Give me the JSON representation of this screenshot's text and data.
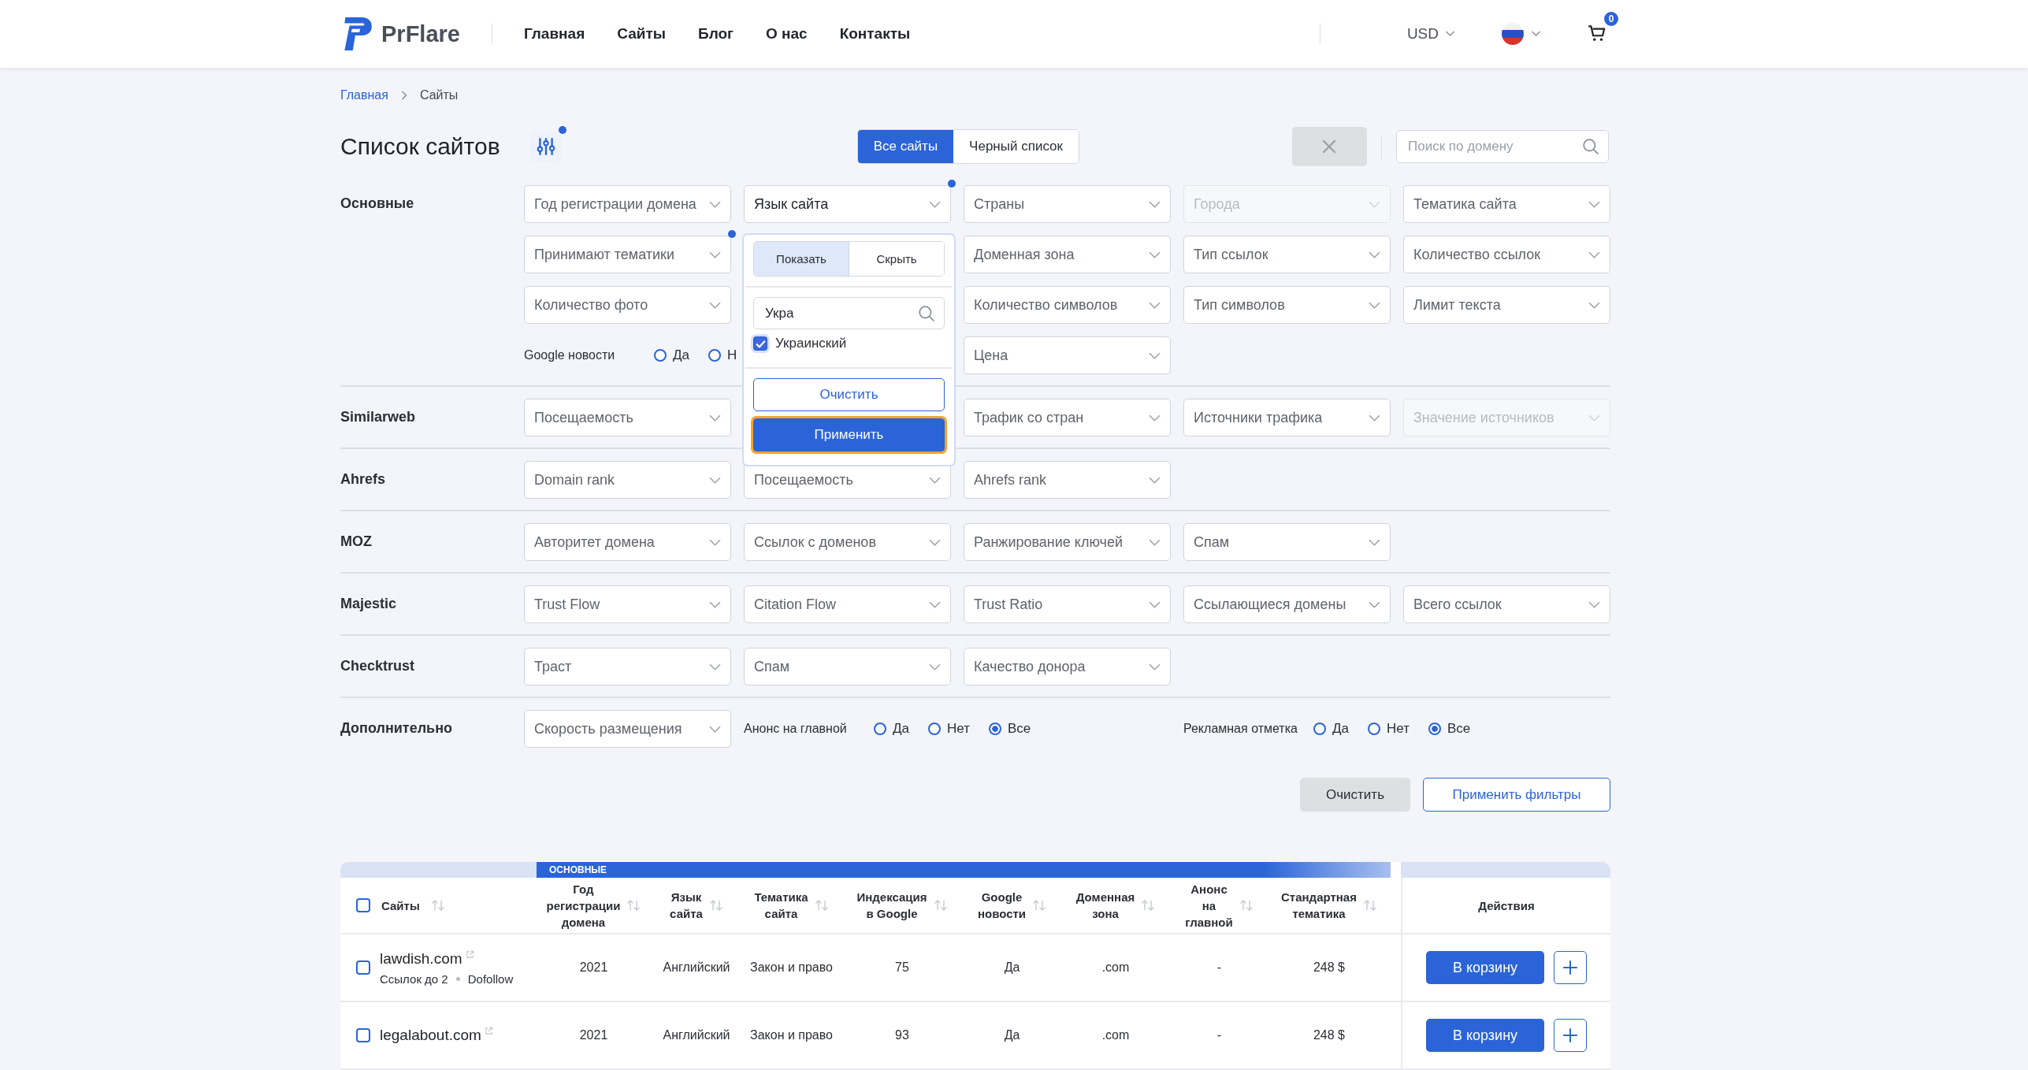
{
  "header": {
    "logo": "PrFlare",
    "nav": [
      {
        "label": "Главная"
      },
      {
        "label": "Сайты"
      },
      {
        "label": "Блог"
      },
      {
        "label": "О нас"
      },
      {
        "label": "Контакты"
      }
    ],
    "currency": "USD",
    "cart_count": "0"
  },
  "breadcrumbs": [
    {
      "label": "Главная",
      "link": true
    },
    {
      "label": "Сайты",
      "link": false
    }
  ],
  "page_title": "Список сайтов",
  "filter_toggle": {
    "active": true
  },
  "tabs": [
    {
      "label": "Все сайты",
      "selected": true
    },
    {
      "label": "Черный список",
      "selected": false
    }
  ],
  "reset_disabled": true,
  "search": {
    "placeholder": "Поиск по домену"
  },
  "filter_sections": [
    {
      "label": "Основные",
      "items": [
        {
          "kind": "select",
          "label": "Год регистрации домена",
          "active": false,
          "disabled": false,
          "open": false
        },
        {
          "kind": "select",
          "label": "Язык сайта",
          "active": true,
          "disabled": false,
          "open": true,
          "popup": {
            "toggle": [
              {
                "label": "Показать",
                "selected": true
              },
              {
                "label": "Скрыть",
                "selected": false
              }
            ],
            "search_value": "Укра",
            "options": [
              {
                "label": "Украинский",
                "checked": true
              }
            ],
            "clear_label": "Очистить",
            "apply_label": "Применить"
          }
        },
        {
          "kind": "select",
          "label": "Страны",
          "active": false,
          "disabled": false,
          "open": false
        },
        {
          "kind": "select",
          "label": "Города",
          "active": false,
          "disabled": true,
          "open": false
        },
        {
          "kind": "select",
          "label": "Тематика сайта",
          "active": false,
          "disabled": false,
          "open": false
        },
        {
          "kind": "select",
          "label": "Принимают тематики",
          "active": true,
          "disabled": false,
          "open": false
        },
        {
          "kind": "select",
          "label": "Доменная зона",
          "active": false,
          "disabled": false,
          "open": false
        },
        {
          "kind": "select",
          "label": "Тип ссылок",
          "active": false,
          "disabled": false,
          "open": false
        },
        {
          "kind": "select",
          "label": "Количество ссылок",
          "active": false,
          "disabled": false,
          "open": false
        },
        {
          "kind": "select",
          "label": "Количество фото",
          "active": false,
          "disabled": false,
          "open": false
        },
        {
          "kind": "select",
          "label": "Количество символов",
          "active": false,
          "disabled": false,
          "open": false
        },
        {
          "kind": "select",
          "label": "Тип символов",
          "active": false,
          "disabled": false,
          "open": false
        },
        {
          "kind": "select",
          "label": "Лимит текста",
          "active": false,
          "disabled": false,
          "open": false
        },
        {
          "kind": "radio_group",
          "label": "Google новости",
          "options": [
            {
              "label": "Да",
              "selected": false
            },
            {
              "label": "Н",
              "selected": false
            }
          ]
        },
        {
          "kind": "select",
          "label": "Цена",
          "active": false,
          "disabled": false,
          "open": false
        }
      ]
    },
    {
      "label": "Similarweb",
      "items": [
        {
          "kind": "select",
          "label": "Посещаемость",
          "active": false,
          "disabled": false,
          "open": false
        },
        {
          "kind": "select",
          "label": "Трафик со стран",
          "active": false,
          "disabled": false,
          "open": false
        },
        {
          "kind": "select",
          "label": "Источники трафика",
          "active": false,
          "disabled": false,
          "open": false
        },
        {
          "kind": "select",
          "label": "Значение источников",
          "active": false,
          "disabled": true,
          "open": false
        }
      ]
    },
    {
      "label": "Ahrefs",
      "items": [
        {
          "kind": "select",
          "label": "Domain rank",
          "active": false,
          "disabled": false,
          "open": false
        },
        {
          "kind": "select",
          "label": "Посещаемость",
          "active": false,
          "disabled": false,
          "open": false
        },
        {
          "kind": "select",
          "label": "Ahrefs rank",
          "active": false,
          "disabled": false,
          "open": false
        }
      ]
    },
    {
      "label": "MOZ",
      "items": [
        {
          "kind": "select",
          "label": "Авторитет домена",
          "active": false,
          "disabled": false,
          "open": false
        },
        {
          "kind": "select",
          "label": "Ссылок с доменов",
          "active": false,
          "disabled": false,
          "open": false
        },
        {
          "kind": "select",
          "label": "Ранжирование ключей",
          "active": false,
          "disabled": false,
          "open": false
        },
        {
          "kind": "select",
          "label": "Спам",
          "active": false,
          "disabled": false,
          "open": false
        }
      ]
    },
    {
      "label": "Majestic",
      "items": [
        {
          "kind": "select",
          "label": "Trust Flow",
          "active": false,
          "disabled": false,
          "open": false
        },
        {
          "kind": "select",
          "label": "Citation Flow",
          "active": false,
          "disabled": false,
          "open": false
        },
        {
          "kind": "select",
          "label": "Trust Ratio",
          "active": false,
          "disabled": false,
          "open": false
        },
        {
          "kind": "select",
          "label": "Ссылающиеся домены",
          "active": false,
          "disabled": false,
          "open": false
        },
        {
          "kind": "select",
          "label": "Всего ссылок",
          "active": false,
          "disabled": false,
          "open": false
        }
      ]
    },
    {
      "label": "Checktrust",
      "items": [
        {
          "kind": "select",
          "label": "Траст",
          "active": false,
          "disabled": false,
          "open": false
        },
        {
          "kind": "select",
          "label": "Спам",
          "active": false,
          "disabled": false,
          "open": false
        },
        {
          "kind": "select",
          "label": "Качество донора",
          "active": false,
          "disabled": false,
          "open": false
        }
      ]
    },
    {
      "label": "Дополнительно",
      "items": [
        {
          "kind": "select",
          "label": "Скорость размещения",
          "active": false,
          "disabled": false,
          "open": false
        },
        {
          "kind": "radio_group",
          "label": "Анонс на главной",
          "options": [
            {
              "label": "Да",
              "selected": false
            },
            {
              "label": "Нет",
              "selected": false
            },
            {
              "label": "Все",
              "selected": true
            }
          ]
        },
        {
          "kind": "radio_group",
          "label": "Рекламная отметка",
          "options": [
            {
              "label": "Да",
              "selected": false
            },
            {
              "label": "Нет",
              "selected": false
            },
            {
              "label": "Все",
              "selected": true
            }
          ]
        }
      ]
    }
  ],
  "filter_actions": {
    "clear": "Очистить",
    "apply": "Применить фильтры"
  },
  "table": {
    "group_label": "ОСНОВНЫЕ",
    "columns": [
      {
        "label": "Сайты",
        "sortable": true
      },
      {
        "label": "Год регистрации домена",
        "sortable": true
      },
      {
        "label": "Язык сайта",
        "sortable": true
      },
      {
        "label": "Тематика сайта",
        "sortable": true
      },
      {
        "label": "Индексация в Google",
        "sortable": true
      },
      {
        "label": "Google новости",
        "sortable": true
      },
      {
        "label": "Доменная зона",
        "sortable": true
      },
      {
        "label": "Анонс на главной",
        "sortable": true
      },
      {
        "label": "Стандартная тематика",
        "sortable": true
      },
      {
        "label": "Действия",
        "sortable": false
      }
    ],
    "all_checked": false,
    "rows": [
      {
        "meta": [
          "Ссылок до 2",
          "Dofollow"
        ],
        "checked": false,
        "cells": [
          "lawdish.com",
          "2021",
          "Английский",
          "Закон и право",
          "75",
          "Да",
          ".com",
          "-",
          "248 $"
        ],
        "cart_label": "В корзину"
      },
      {
        "checked": false,
        "cells": [
          "legalabout.com",
          "2021",
          "Английский",
          "Закон и право",
          "93",
          "Да",
          ".com",
          "-",
          "248 $"
        ],
        "cart_label": "В корзину"
      }
    ]
  }
}
